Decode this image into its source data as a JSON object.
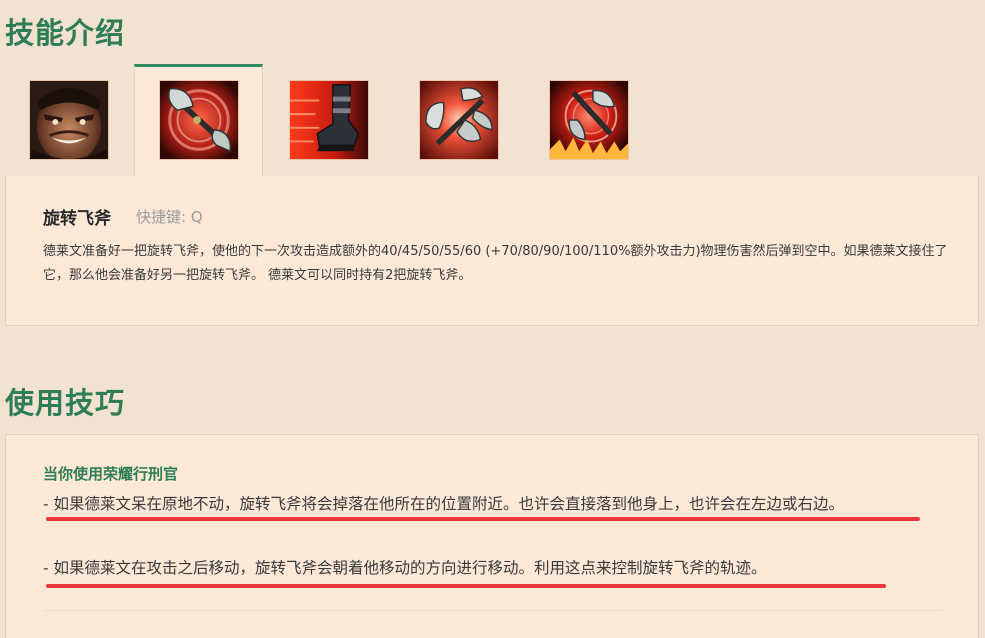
{
  "skills_section": {
    "title": "技能介绍",
    "tabs": [
      {
        "name": "passive",
        "icon": "draven-portrait-icon",
        "active": false
      },
      {
        "name": "q",
        "icon": "spinning-axe-icon",
        "active": true
      },
      {
        "name": "w",
        "icon": "blood-rush-boot-icon",
        "active": false
      },
      {
        "name": "e",
        "icon": "stand-aside-axes-icon",
        "active": false
      },
      {
        "name": "r",
        "icon": "whirling-death-icon",
        "active": false
      }
    ],
    "skill": {
      "name": "旋转飞斧",
      "hotkey": "快捷键: Q",
      "description": "德莱文准备好一把旋转飞斧，使他的下一次攻击造成额外的40/45/50/55/60 (+70/80/90/100/110%额外攻击力)物理伤害然后弹到空中。如果德莱文接住了它，那么他会准备好另一把旋转飞斧。 德莱文可以同时持有2把旋转飞斧。"
    }
  },
  "tips_section": {
    "title": "使用技巧",
    "heading": "当你使用荣耀行刑官",
    "tips": [
      "- 如果德莱文呆在原地不动，旋转飞斧将会掉落在他所在的位置附近。也许会直接落到他身上，也许会在左边或右边。",
      "- 如果德莱文在攻击之后移动，旋转飞斧会朝着他移动的方向进行移动。利用这点来控制旋转飞斧的轨迹。"
    ]
  },
  "colors": {
    "page_bg": "#f1e2d2",
    "panel_bg": "#fbe8d7",
    "accent_green": "#2f7d55",
    "underline_red": "#e8383c",
    "muted_text": "#9d9d9d"
  }
}
